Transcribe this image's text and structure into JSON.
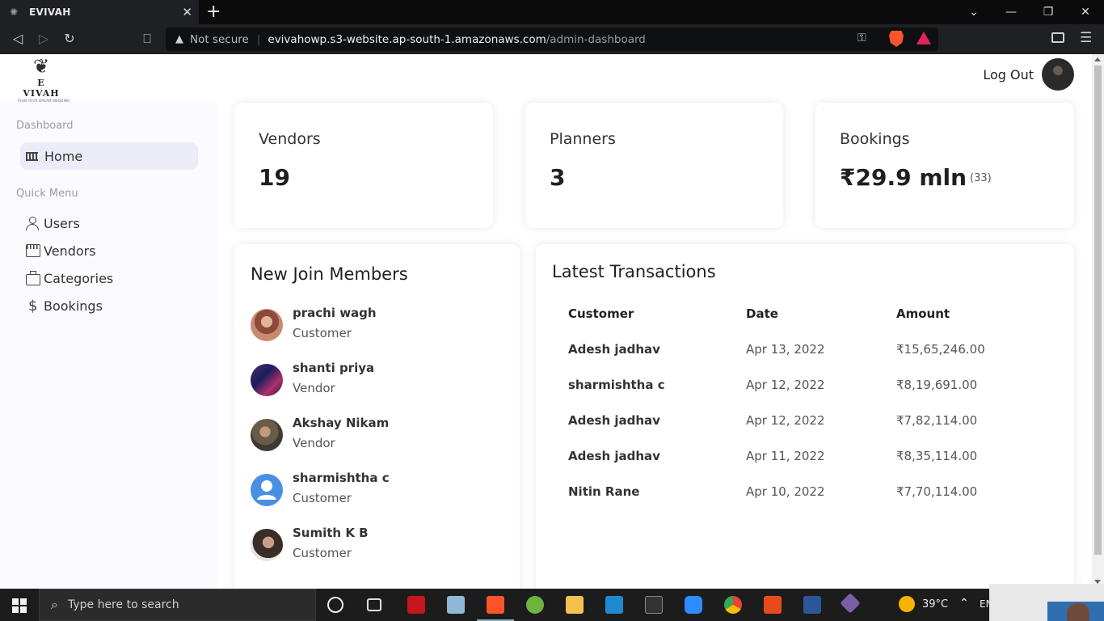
{
  "browser": {
    "tab_title": "EVIVAH",
    "new_tab_label": "+",
    "url_warning": "Not secure",
    "url_host": "evivahowp.s3-website.ap-south-1.amazonaws.com",
    "url_path": "/admin-dashboard"
  },
  "header": {
    "logo_brand": "E VIVAH",
    "logo_tagline": "PLAN YOUR DREAM WEDDING",
    "logout_label": "Log Out"
  },
  "sidebar": {
    "section_dashboard": "Dashboard",
    "home_label": "Home",
    "section_quick_menu": "Quick Menu",
    "items": [
      {
        "label": "Users",
        "icon": "user-icon"
      },
      {
        "label": "Vendors",
        "icon": "store-icon"
      },
      {
        "label": "Categories",
        "icon": "briefcase-icon"
      },
      {
        "label": "Bookings",
        "icon": "dollar-icon"
      }
    ]
  },
  "stats": {
    "vendors": {
      "label": "Vendors",
      "value": "19"
    },
    "planners": {
      "label": "Planners",
      "value": "3"
    },
    "bookings": {
      "label": "Bookings",
      "value": "₹29.9 mln",
      "extra": "(33)"
    }
  },
  "members": {
    "title": "New Join Members",
    "list": [
      {
        "name": "prachi wagh",
        "role": "Customer"
      },
      {
        "name": "shanti priya",
        "role": "Vendor"
      },
      {
        "name": "Akshay Nikam",
        "role": "Vendor"
      },
      {
        "name": "sharmishtha c",
        "role": "Customer"
      },
      {
        "name": "Sumith K B",
        "role": "Customer"
      }
    ]
  },
  "transactions": {
    "title": "Latest Transactions",
    "headers": {
      "customer": "Customer",
      "date": "Date",
      "amount": "Amount"
    },
    "rows": [
      {
        "customer": "Adesh jadhav",
        "date": "Apr 13, 2022",
        "amount": "₹15,65,246.00"
      },
      {
        "customer": "sharmishtha c",
        "date": "Apr 12, 2022",
        "amount": "₹8,19,691.00"
      },
      {
        "customer": "Adesh jadhav",
        "date": "Apr 12, 2022",
        "amount": "₹7,82,114.00"
      },
      {
        "customer": "Adesh jadhav",
        "date": "Apr 11, 2022",
        "amount": "₹8,35,114.00"
      },
      {
        "customer": "Nitin Rane",
        "date": "Apr 10, 2022",
        "amount": "₹7,70,114.00"
      }
    ]
  },
  "taskbar": {
    "search_placeholder": "Type here to search",
    "temperature": "39°C",
    "language": "EN"
  },
  "colors": {
    "sidebar_bg": "#fbfbff",
    "active_item_bg": "#ececf8",
    "browser_chrome": "#1f2023",
    "taskbar": "#1c1c1c"
  }
}
